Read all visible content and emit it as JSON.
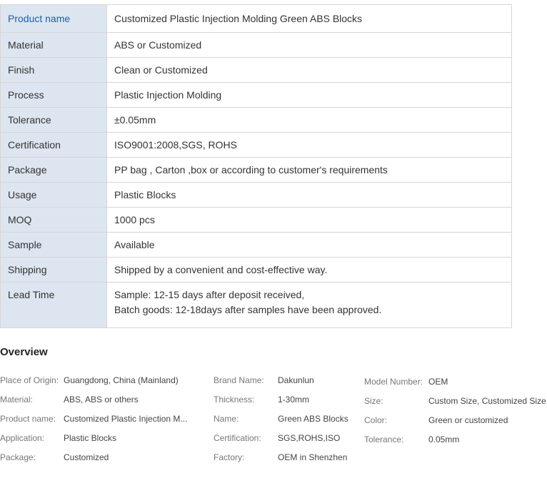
{
  "spec_table": {
    "rows": [
      {
        "key": "Product name",
        "value": "Customized Plastic Injection Molding Green ABS Blocks"
      },
      {
        "key": "Material",
        "value": "ABS or Customized"
      },
      {
        "key": "Finish",
        "value": "Clean or Customized"
      },
      {
        "key": "Process",
        "value": "Plastic Injection Molding"
      },
      {
        "key": "Tolerance",
        "value": "±0.05mm"
      },
      {
        "key": "Certification",
        "value": "ISO9001:2008,SGS, ROHS"
      },
      {
        "key": "Package",
        "value": "PP bag , Carton ,box or according to customer's requirements"
      },
      {
        "key": "Usage",
        "value": "Plastic Blocks"
      },
      {
        "key": "MOQ",
        "value": "1000 pcs"
      },
      {
        "key": "Sample",
        "value": "Available"
      },
      {
        "key": "Shipping",
        "value": "Shipped by a convenient and cost-effective way."
      },
      {
        "key": "Lead Time",
        "value_lines": [
          "Sample: 12-15 days after deposit received,",
          "Batch goods: 12-18days after samples have been approved."
        ]
      }
    ]
  },
  "overview": {
    "title": "Overview",
    "columns": [
      [
        {
          "key": "Place of Origin:",
          "value": "Guangdong, China (Mainland)"
        },
        {
          "key": "Material:",
          "value": "ABS, ABS or others"
        },
        {
          "key": "Product name:",
          "value": "Customized Plastic Injection M..."
        },
        {
          "key": "Application:",
          "value": "Plastic Blocks"
        },
        {
          "key": "Package:",
          "value": "Customized"
        }
      ],
      [
        {
          "key": "Brand Name:",
          "value": "Dakunlun"
        },
        {
          "key": "Thickness:",
          "value": "1-30mm"
        },
        {
          "key": "Name:",
          "value": "Green ABS Blocks"
        },
        {
          "key": "Certification:",
          "value": "SGS,ROHS,ISO"
        },
        {
          "key": "Factory:",
          "value": "OEM in Shenzhen"
        }
      ],
      [
        {
          "key": "Model Number:",
          "value": "OEM"
        },
        {
          "key": "Size:",
          "value": "Custom Size, Customized Size"
        },
        {
          "key": "Color:",
          "value": "Green or customized"
        },
        {
          "key": "Tolerance:",
          "value": "0.05mm"
        }
      ]
    ]
  },
  "colors": {
    "key_cell_bg": "#dde5f0",
    "header_key_text": "#1a5fb4",
    "border": "#d6d6d6"
  }
}
